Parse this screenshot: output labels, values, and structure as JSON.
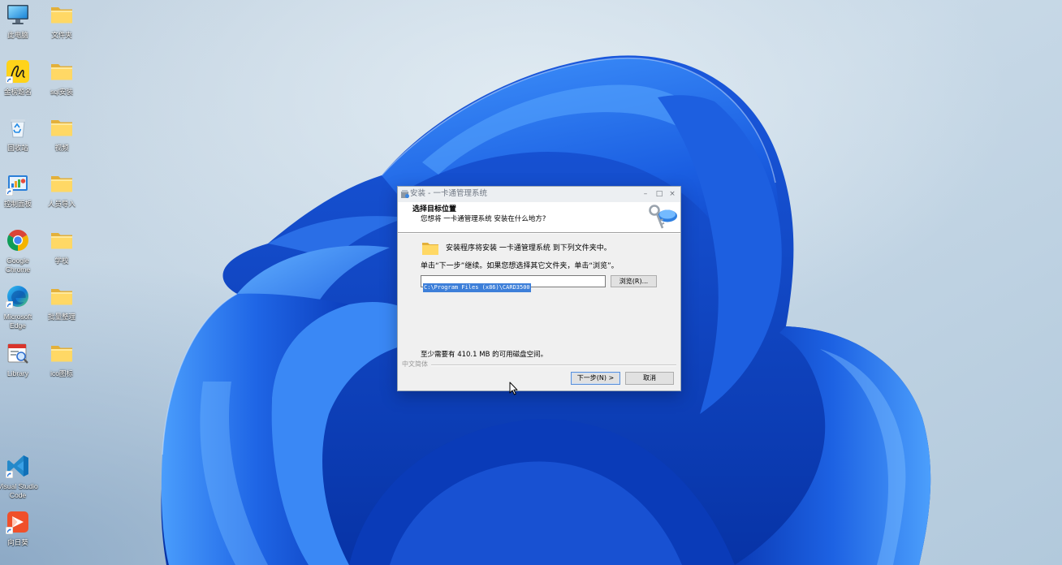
{
  "desktop": {
    "left_column": [
      {
        "label": "此电脑",
        "icon": "computer-icon"
      },
      {
        "label": "金榜题名",
        "icon": "app-icon"
      },
      {
        "label": "回收站",
        "icon": "recycle-bin-icon"
      },
      {
        "label": "控制面板",
        "icon": "control-panel-icon"
      },
      {
        "label": "Google Chrome",
        "icon": "chrome-icon"
      },
      {
        "label": "Microsoft Edge",
        "icon": "edge-icon"
      },
      {
        "label": "Library",
        "icon": "library-icon"
      },
      {
        "label": "Visual Studio Code",
        "icon": "vscode-icon"
      },
      {
        "label": "向日葵",
        "icon": "sunlogin-icon"
      }
    ],
    "right_column": [
      {
        "label": "文件夹",
        "icon": "folder-icon"
      },
      {
        "label": "sql安装",
        "icon": "folder-icon"
      },
      {
        "label": "视频",
        "icon": "folder-icon"
      },
      {
        "label": "人员导入",
        "icon": "folder-icon"
      },
      {
        "label": "学校",
        "icon": "folder-icon"
      },
      {
        "label": "批量整理",
        "icon": "folder-icon"
      },
      {
        "label": "ico图标",
        "icon": "folder-icon"
      }
    ]
  },
  "installer": {
    "title": "安装 - 一卡通管理系统",
    "window_controls": {
      "minimize": "–",
      "maximize": "□",
      "close": "×"
    },
    "header": {
      "title": "选择目标位置",
      "subtitle": "您想将 一卡通管理系统 安装在什么地方?"
    },
    "install_note": "安装程序将安装 一卡通管理系统 到下列文件夹中。",
    "instruction": "单击“下一步”继续。如果您想选择其它文件夹，单击“浏览”。",
    "destination_path": "C:\\Program Files (x86)\\CARD3500",
    "browse_label": "浏览(R)...",
    "disk_space_note": "至少需要有 410.1 MB 的可用磁盘空间。",
    "language_label": "中文简体",
    "next_label": "下一步(N) >",
    "cancel_label": "取消"
  },
  "colors": {
    "selection": "#3d7fd9",
    "dialog_background": "#f0f0f0",
    "bloom_blue": "#1a58dc"
  }
}
